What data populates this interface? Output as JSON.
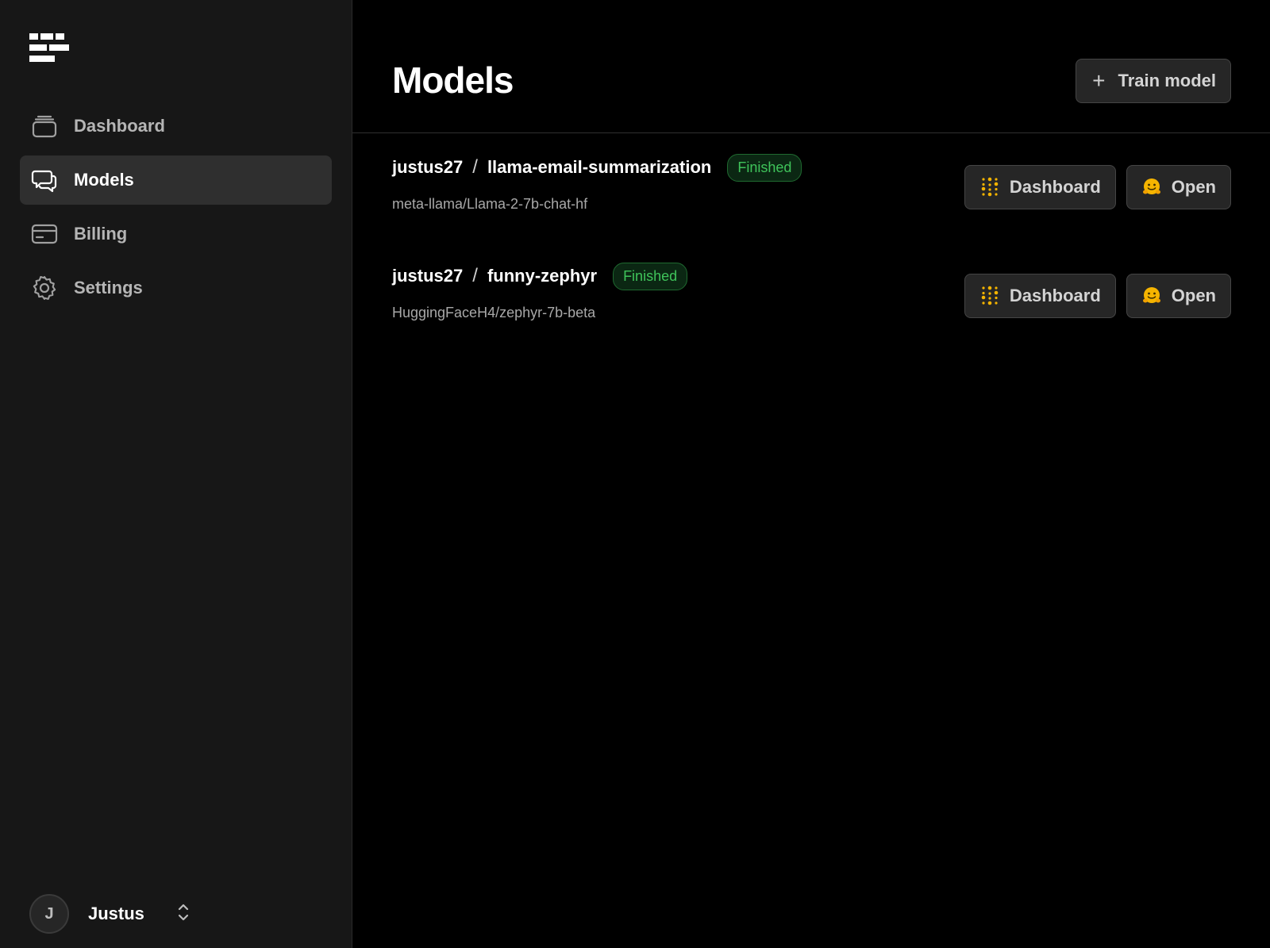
{
  "sidebar": {
    "items": [
      {
        "label": "Dashboard",
        "icon": "layers-icon"
      },
      {
        "label": "Models",
        "icon": "chat-bubbles-icon",
        "active": true
      },
      {
        "label": "Billing",
        "icon": "credit-card-icon"
      },
      {
        "label": "Settings",
        "icon": "gear-icon"
      }
    ],
    "user": {
      "initial": "J",
      "name": "Justus"
    }
  },
  "header": {
    "title": "Models",
    "train_button_label": "Train model"
  },
  "models": [
    {
      "owner": "justus27",
      "separator": "/",
      "name": "llama-email-summarization",
      "status": "Finished",
      "base_model": "meta-llama/Llama-2-7b-chat-hf",
      "dashboard_label": "Dashboard",
      "open_label": "Open"
    },
    {
      "owner": "justus27",
      "separator": "/",
      "name": "funny-zephyr",
      "status": "Finished",
      "base_model": "HuggingFaceH4/zephyr-7b-beta",
      "dashboard_label": "Dashboard",
      "open_label": "Open"
    }
  ],
  "colors": {
    "status_green": "#3fc35a",
    "accent_yellow": "#f5b400",
    "sidebar_bg": "#171717"
  }
}
